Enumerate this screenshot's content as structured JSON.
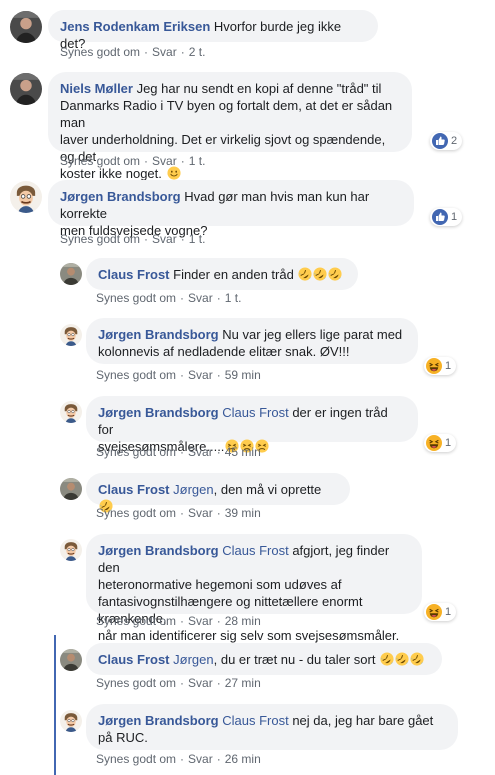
{
  "comments": [
    {
      "author": "Jens Rodenkam Eriksen",
      "text": " Hvorfor burde jeg ikke det?",
      "like": "Synes godt om",
      "reply": "Svar",
      "time": "2 t."
    },
    {
      "author": "Niels Møller",
      "text_line1": " Jeg har nu sendt en kopi af denne \"tråd\" til",
      "text_line2": "Danmarks Radio i TV byen og fortalt dem, at det er sådan man",
      "text_line3": "laver underholdning. Det er virkelig sjovt og spændende, og det",
      "text_line4": "koster ikke noget.",
      "like": "Synes godt om",
      "reply": "Svar",
      "time": "1 t.",
      "reaction_count": "2"
    },
    {
      "author": "Jørgen Brandsborg",
      "text_line1": " Hvad gør man hvis man kun har korrekte",
      "text_line2": "men fuldsvejsede vogne?",
      "like": "Synes godt om",
      "reply": "Svar",
      "time": "1 t.",
      "reaction_count": "1"
    },
    {
      "author": "Claus Frost",
      "text": " Finder en anden tråd",
      "like": "Synes godt om",
      "reply": "Svar",
      "time": "1 t."
    },
    {
      "author": "Jørgen Brandsborg",
      "text_line1": " Nu var jeg ellers lige parat med",
      "text_line2": "kolonnevis af nedladende elitær snak. ØV!!!",
      "like": "Synes godt om",
      "reply": "Svar",
      "time": "59 min",
      "reaction_count": "1"
    },
    {
      "author": "Jørgen Brandsborg",
      "mention": "Claus Frost",
      "text_line1": " der er ingen tråd for",
      "text_line2": "svejsesømsmålere.....",
      "like": "Synes godt om",
      "reply": "Svar",
      "time": "45 min",
      "reaction_count": "1"
    },
    {
      "author": "Claus Frost",
      "mention": "Jørgen",
      "text": ", den må vi oprette",
      "like": "Synes godt om",
      "reply": "Svar",
      "time": "39 min"
    },
    {
      "author": "Jørgen Brandsborg",
      "mention": "Claus Frost",
      "text_line1": " afgjort, jeg finder den",
      "text_line2": "heteronormative hegemoni som udøves af",
      "text_line3": "fantasivognstilhængere og nittetællere enormt krænkende,",
      "text_line4": "når man identificerer sig selv som svejsesømsmåler.",
      "like": "Synes godt om",
      "reply": "Svar",
      "time": "28 min",
      "reaction_count": "1"
    },
    {
      "author": "Claus Frost",
      "mention": "Jørgen",
      "text": ", du er træt nu - du taler sort",
      "like": "Synes godt om",
      "reply": "Svar",
      "time": "27 min"
    },
    {
      "author": "Jørgen Brandsborg",
      "mention": "Claus Frost",
      "text_line1": " nej da, jeg har bare gået",
      "text_line2": "på RUC.",
      "like": "Synes godt om",
      "reply": "Svar",
      "time": "26 min"
    }
  ],
  "colors": {
    "link": "#385898",
    "bubble": "#f2f3f5",
    "meta": "#606770",
    "like_blue": "#4267b2",
    "haha_yellow": "#f7b125"
  }
}
